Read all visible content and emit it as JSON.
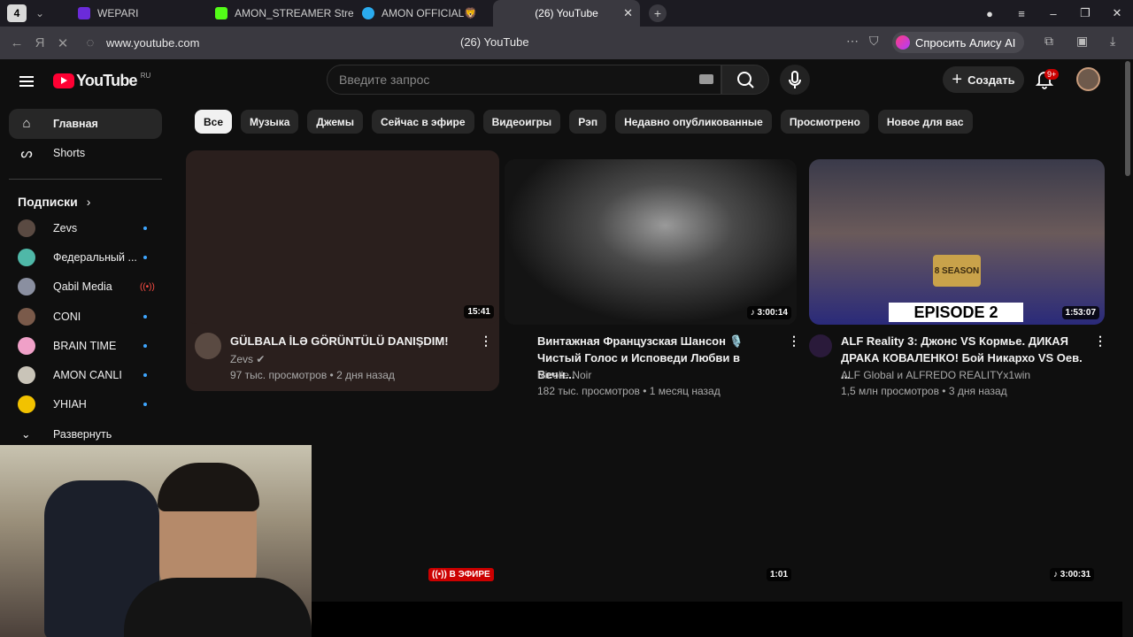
{
  "browser": {
    "tab_count": "4",
    "tabs": [
      {
        "label": "WEPARI",
        "color": "#6b2bd9"
      },
      {
        "label": "AMON_STREAMER Stream",
        "color": "#53fc18"
      },
      {
        "label": "AMON OFFICIAL🦁",
        "color": "#2aabee"
      },
      {
        "label": "(26) YouTube",
        "color": "#3a3940"
      }
    ],
    "url": "www.youtube.com",
    "page_title": "(26) YouTube",
    "alice_label": "Спросить Алису AI"
  },
  "youtube": {
    "logo_text": "YouTube",
    "region": "RU",
    "search_placeholder": "Введите запрос",
    "create_label": "Создать",
    "notifications_badge": "9+",
    "sidebar": {
      "home": "Главная",
      "shorts": "Shorts",
      "subscriptions_header": "Подписки",
      "subscriptions": [
        {
          "name": "Zevs",
          "color": "#5a4a42",
          "status": "new"
        },
        {
          "name": "Федеральный ...",
          "color": "#4fb8a8",
          "status": "new"
        },
        {
          "name": "Qabil Media",
          "color": "#8a8fa0",
          "status": "live"
        },
        {
          "name": "CONI",
          "color": "#7a5a4a",
          "status": "new"
        },
        {
          "name": "BRAIN TIME",
          "color": "#f0a0c8",
          "status": "new"
        },
        {
          "name": "AMON CANLI",
          "color": "#c9c4b8",
          "status": "new"
        },
        {
          "name": "УНІАН",
          "color": "#f2c200",
          "status": "new"
        }
      ],
      "expand": "Развернуть"
    },
    "chips": [
      "Все",
      "Музыка",
      "Джемы",
      "Сейчас в эфире",
      "Видеоигры",
      "Рэп",
      "Недавно опубликованные",
      "Просмотрено",
      "Новое для вас"
    ],
    "videos": [
      {
        "title": "GÜLBALA İLƏ GÖRÜNTÜLÜ DANIŞDIM!",
        "channel": "Zevs",
        "meta": "97 тыс. просмотров • 2 дня назад",
        "duration": "15:41"
      },
      {
        "title": "Винтажная Французская Шансон 🎙️ Чистый Голос и Исповеди Любви в Вечн...",
        "channel": "Nicolle Noir",
        "meta": "182 тыс. просмотров • 1 месяц назад",
        "duration": "♪ 3:00:14"
      },
      {
        "title": "ALF Reality 3: Джонс VS Кормье. ДИКАЯ ДРАКА КОВАЛЕНКО! Бой Никархо VS Оев. ...",
        "channel": "ALF Global и ALFREDO REALITYx1win",
        "meta": "1,5 млн просмотров • 3 дня назад",
        "duration": "1:53:07",
        "thumb_text": "EPISODE 2",
        "badge_text": "8 SEASON"
      }
    ],
    "row2": {
      "live_badge": "В ЭФИРЕ",
      "duration2": "1:01",
      "duration3": "♪ 3:00:31"
    }
  }
}
